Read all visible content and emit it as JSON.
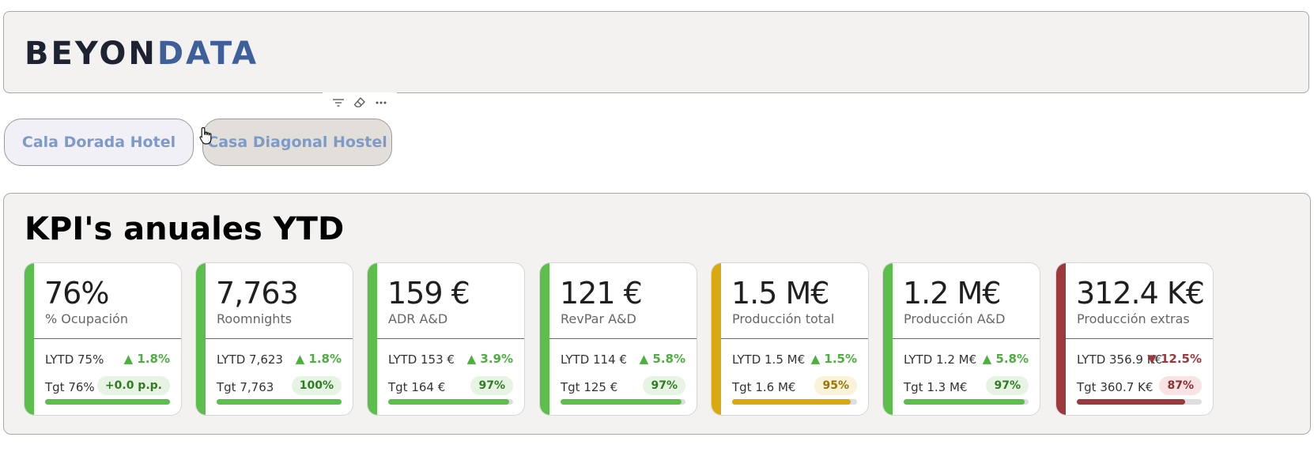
{
  "header": {
    "logo_part1": "BEYON",
    "logo_part2": "DATA"
  },
  "toolbar": {
    "icons": [
      "filter-icon",
      "eraser-icon",
      "more-options-icon"
    ]
  },
  "slicer": {
    "buttons": [
      "Cala Dorada Hotel",
      "Casa Diagonal Hostel"
    ]
  },
  "kpi": {
    "title": "KPI's anuales YTD",
    "cards": [
      {
        "value": "76%",
        "label": "% Ocupación",
        "lytd": "LYTD 75%",
        "delta": "▲ 1.8%",
        "delta_status": "up",
        "tgt": "Tgt 76%",
        "badge": "+0.0 p.p.",
        "progress": 1.0,
        "status": "green"
      },
      {
        "value": "7,763",
        "label": "Roomnights",
        "lytd": "LYTD 7,623",
        "delta": "▲ 1.8%",
        "delta_status": "up",
        "tgt": "Tgt 7,763",
        "badge": "100%",
        "progress": 1.0,
        "status": "green"
      },
      {
        "value": "159 €",
        "label": "ADR A&D",
        "lytd": "LYTD 153 €",
        "delta": "▲ 3.9%",
        "delta_status": "up",
        "tgt": "Tgt 164 €",
        "badge": "97%",
        "progress": 0.97,
        "status": "green"
      },
      {
        "value": "121 €",
        "label": "RevPar A&D",
        "lytd": "LYTD 114 €",
        "delta": "▲ 5.8%",
        "delta_status": "up",
        "tgt": "Tgt 125 €",
        "badge": "97%",
        "progress": 0.97,
        "status": "green"
      },
      {
        "value": "1.5 M€",
        "label": "Producción total",
        "lytd": "LYTD 1.5 M€",
        "delta": "▲ 1.5%",
        "delta_status": "up",
        "tgt": "Tgt 1.6 M€",
        "badge": "95%",
        "progress": 0.95,
        "status": "yellow"
      },
      {
        "value": "1.2 M€",
        "label": "Producción A&D",
        "lytd": "LYTD 1.2 M€",
        "delta": "▲ 5.8%",
        "delta_status": "up",
        "tgt": "Tgt 1.3 M€",
        "badge": "97%",
        "progress": 0.97,
        "status": "green"
      },
      {
        "value": "312.4 K€",
        "label": "Producción extras",
        "lytd": "LYTD 356.9 K€",
        "delta": "▼ 12.5%",
        "delta_status": "down",
        "tgt": "Tgt 360.7 K€",
        "badge": "87%",
        "progress": 0.87,
        "status": "red"
      }
    ]
  },
  "colors": {
    "green": "#5cbf4c",
    "yellow": "#d9a90f",
    "red": "#9b3a3e",
    "delta_up": "#4caf3f",
    "delta_down": "#9b3a3e",
    "badge_green_bg": "#e7f4e4",
    "badge_green_text": "#2e7d24",
    "badge_yellow_bg": "#fbf3d9",
    "badge_yellow_text": "#9a7406",
    "badge_red_bg": "#f7e3e4",
    "badge_red_text": "#8a2f33"
  }
}
